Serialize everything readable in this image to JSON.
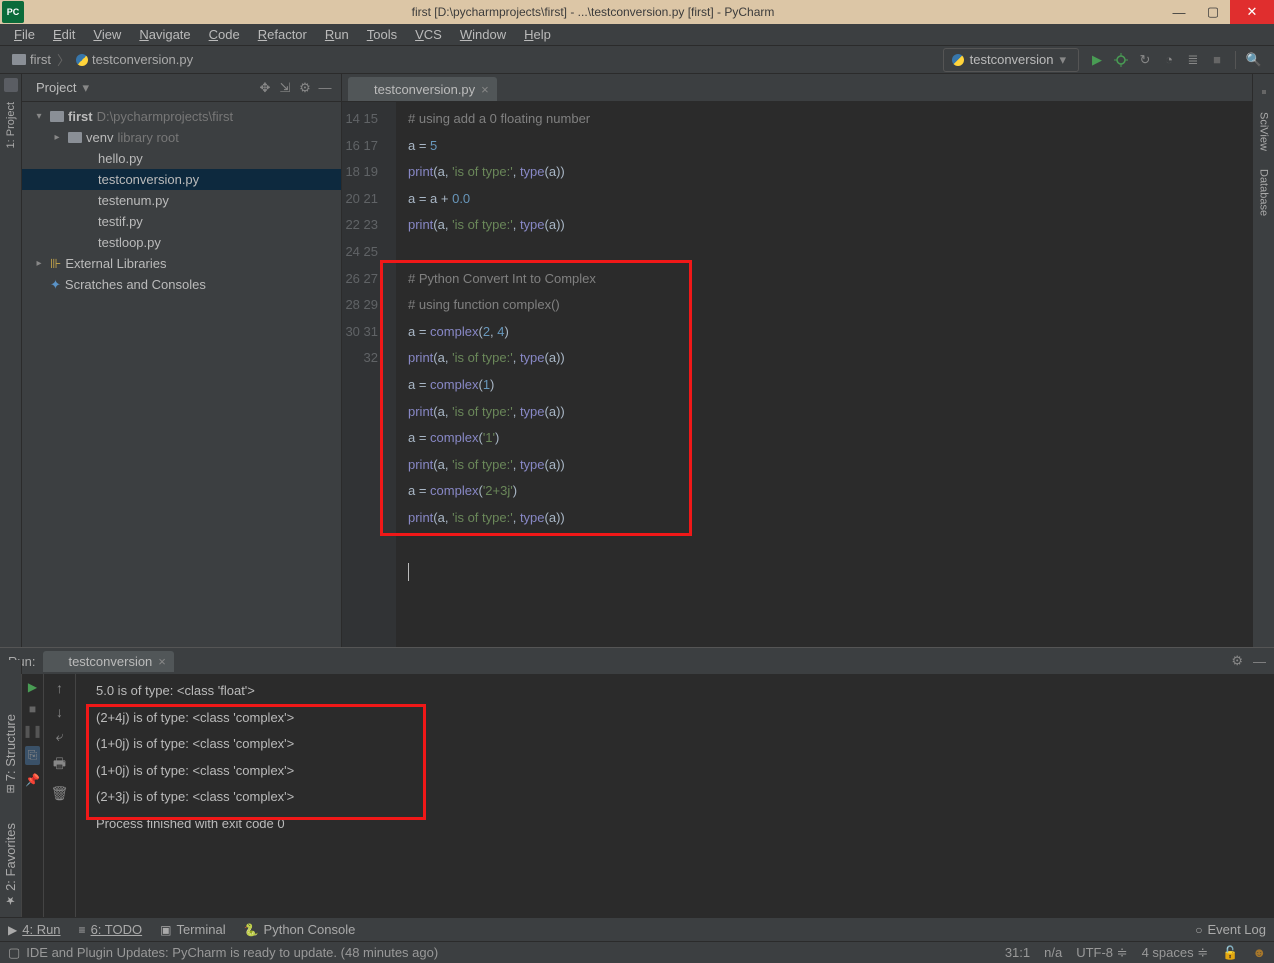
{
  "window": {
    "title": "first [D:\\pycharmprojects\\first] - ...\\testconversion.py [first] - PyCharm",
    "app_abbr": "PC"
  },
  "menu": [
    "File",
    "Edit",
    "View",
    "Navigate",
    "Code",
    "Refactor",
    "Run",
    "Tools",
    "VCS",
    "Window",
    "Help"
  ],
  "breadcrumbs": {
    "project": "first",
    "file": "testconversion.py"
  },
  "run_config": {
    "label": "testconversion"
  },
  "project_panel": {
    "title": "Project",
    "root": {
      "name": "first",
      "path": "D:\\pycharmprojects\\first"
    },
    "venv": {
      "name": "venv",
      "suffix": "library root"
    },
    "files": [
      "hello.py",
      "testconversion.py",
      "testenum.py",
      "testif.py",
      "testloop.py"
    ],
    "ext": "External Libraries",
    "scratches": "Scratches and Consoles"
  },
  "tab": {
    "name": "testconversion.py"
  },
  "code_lines": [
    {
      "n": 14,
      "html": "<span class='comment'># using add a 0 floating number</span>"
    },
    {
      "n": 15,
      "html": "a = <span class='num'>5</span>"
    },
    {
      "n": 16,
      "html": "<span class='bi'>print</span>(a, <span class='str'>'is of type:'</span>, <span class='bi'>type</span>(a))"
    },
    {
      "n": 17,
      "html": "a = a + <span class='num'>0.0</span>"
    },
    {
      "n": 18,
      "html": "<span class='bi'>print</span>(a, <span class='str'>'is of type:'</span>, <span class='bi'>type</span>(a))"
    },
    {
      "n": 19,
      "html": ""
    },
    {
      "n": 20,
      "html": "<span class='comment'># Python Convert Int to Complex</span>"
    },
    {
      "n": 21,
      "html": "<span class='comment'># using function complex()</span>"
    },
    {
      "n": 22,
      "html": "a = <span class='bi'>complex</span>(<span class='num'>2</span>, <span class='num'>4</span>)"
    },
    {
      "n": 23,
      "html": "<span class='bi'>print</span>(a, <span class='str'>'is of type:'</span>, <span class='bi'>type</span>(a))"
    },
    {
      "n": 24,
      "html": "a = <span class='bi'>complex</span>(<span class='num'>1</span>)"
    },
    {
      "n": 25,
      "html": "<span class='bi'>print</span>(a, <span class='str'>'is of type:'</span>, <span class='bi'>type</span>(a))"
    },
    {
      "n": 26,
      "html": "a = <span class='bi'>complex</span>(<span class='str'>'1'</span>)"
    },
    {
      "n": 27,
      "html": "<span class='bi'>print</span>(a, <span class='str'>'is of type:'</span>, <span class='bi'>type</span>(a))"
    },
    {
      "n": 28,
      "html": "a = <span class='bi'>complex</span>(<span class='str'>'2+3j'</span>)"
    },
    {
      "n": 29,
      "html": "<span class='bi'>print</span>(a, <span class='str'>'is of type:'</span>, <span class='bi'>type</span>(a))"
    },
    {
      "n": 30,
      "html": ""
    },
    {
      "n": 31,
      "html": "<span class='caret'></span>"
    },
    {
      "n": 32,
      "html": ""
    }
  ],
  "run": {
    "label": "Run:",
    "tab": "testconversion",
    "output": [
      "5.0 is of type: <class 'float'>",
      "(2+4j) is of type: <class 'complex'>",
      "(1+0j) is of type: <class 'complex'>",
      "(1+0j) is of type: <class 'complex'>",
      "(2+3j) is of type: <class 'complex'>",
      "",
      "Process finished with exit code 0"
    ]
  },
  "bottom_tools": {
    "run": "4: Run",
    "todo": "6: TODO",
    "terminal": "Terminal",
    "python": "Python Console",
    "eventlog": "Event Log"
  },
  "status": {
    "msg": "IDE and Plugin Updates: PyCharm is ready to update. (48 minutes ago)",
    "pos": "31:1",
    "na": "n/a",
    "enc": "UTF-8",
    "indent": "4 spaces"
  },
  "side_left": {
    "project": "1: Project"
  },
  "side_left_lower": {
    "structure": "7: Structure",
    "favorites": "2: Favorites"
  },
  "side_right": {
    "sciview": "SciView",
    "database": "Database"
  }
}
